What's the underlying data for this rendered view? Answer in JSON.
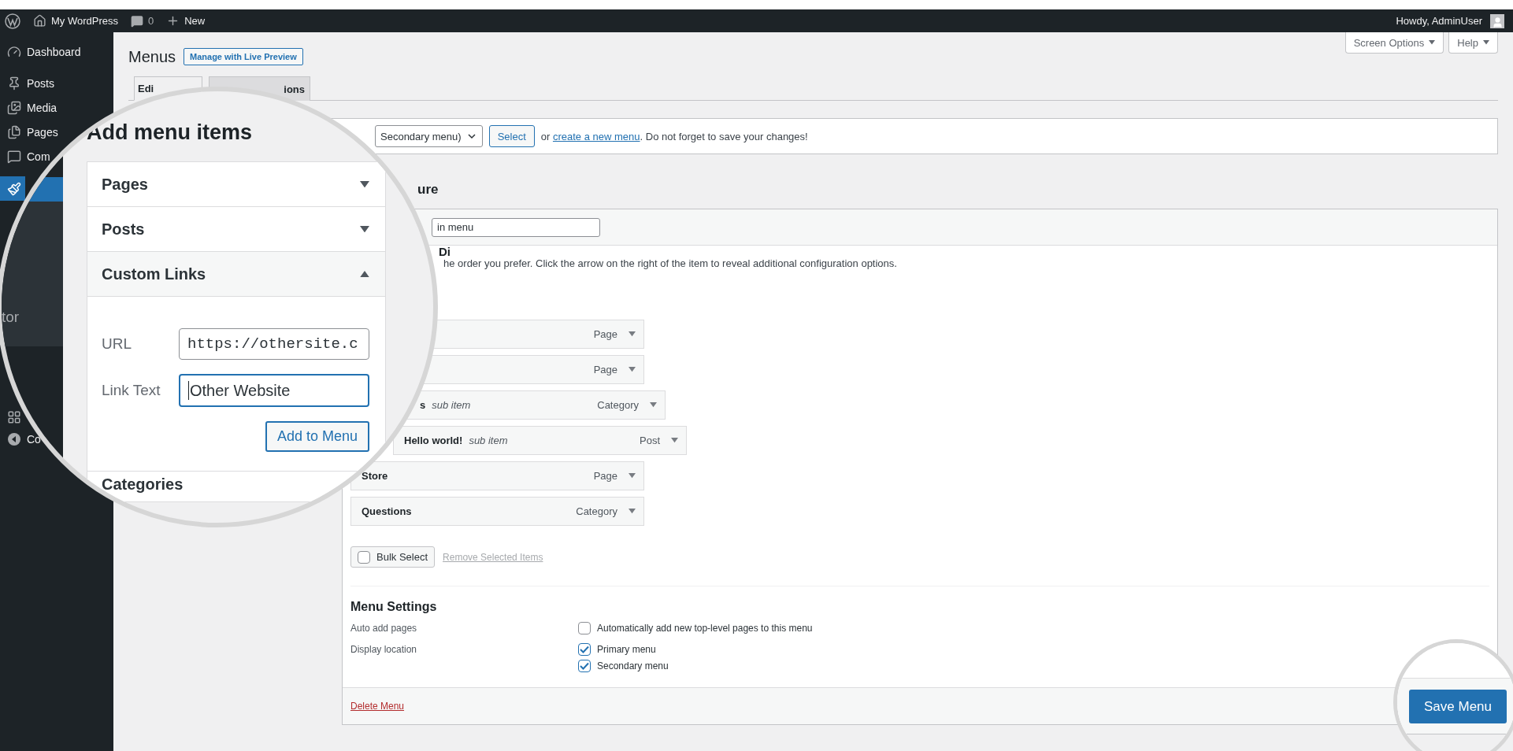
{
  "admin_bar": {
    "site_name": "My WordPress",
    "comments_count": "0",
    "new_label": "New",
    "greeting": "Howdy, AdminUser"
  },
  "sidebar": {
    "items": [
      {
        "label": "Dashboard",
        "selected": false
      },
      {
        "label": "Posts",
        "selected": false
      },
      {
        "label": "Media",
        "selected": false
      },
      {
        "label": "Pages",
        "selected": false
      },
      {
        "label": "Com",
        "selected": false
      },
      {
        "selected": true
      }
    ],
    "bottom_items": [
      {
        "kind": "tool"
      },
      {
        "kind": "collapse",
        "label": "Co"
      }
    ]
  },
  "header": {
    "title": "Menus",
    "live_preview_button": "Manage with Live Preview",
    "screen_options": "Screen Options",
    "help": "Help"
  },
  "tabs": [
    {
      "label": "Edi",
      "selected": true
    },
    {
      "label": "ions",
      "selected": false
    }
  ],
  "select_bar": {
    "select_value": "Secondary menu)",
    "select_button": "Select",
    "text_before": "or ",
    "link": "create a new menu",
    "text_after": ". Do not forget to save your changes!"
  },
  "menu_structure": {
    "heading": "ure",
    "name_value": "in menu",
    "drag_heading": "Di",
    "instructions": "he order you prefer. Click the arrow on the right of the item to reveal additional configuration options.",
    "items": [
      {
        "type": "Page"
      },
      {
        "type": "Page",
        "children": [
          {
            "title": "s",
            "note": "sub item",
            "type": "Category",
            "children": [
              {
                "title": "Hello world!",
                "note": "sub item",
                "type": "Post"
              }
            ]
          }
        ]
      },
      {
        "title": "Store",
        "type": "Page"
      },
      {
        "title": "Questions",
        "type": "Category"
      }
    ],
    "bulk_select": {
      "label": "Bulk Select",
      "checked": false
    },
    "remove_link": {
      "label": "Remove Selected Items",
      "disabled": true
    }
  },
  "settings": {
    "title": "Menu Settings",
    "rows": [
      {
        "label": "Auto add pages",
        "options": [
          {
            "label": "Automatically add new top-level pages to this menu",
            "checked": false
          }
        ]
      },
      {
        "label": "Display location",
        "options": [
          {
            "label": "Primary menu",
            "checked": true
          },
          {
            "label": "Secondary menu",
            "checked": true
          }
        ]
      }
    ]
  },
  "footer": {
    "delete_link": "Delete Menu",
    "save_button": "Save Menu"
  },
  "magnifier": {
    "sidebar_fragment": "tor",
    "heading": "Add menu items",
    "sections": [
      {
        "title": "Pages",
        "expanded": false
      },
      {
        "title": "Posts",
        "expanded": false
      },
      {
        "title": "Custom Links",
        "expanded": true
      }
    ],
    "url_label": "URL",
    "url_value": "https://othersite.c",
    "link_text_label": "Link Text",
    "link_text_value": "Other Website",
    "add_button": "Add to Menu",
    "next_section": "Categories"
  }
}
